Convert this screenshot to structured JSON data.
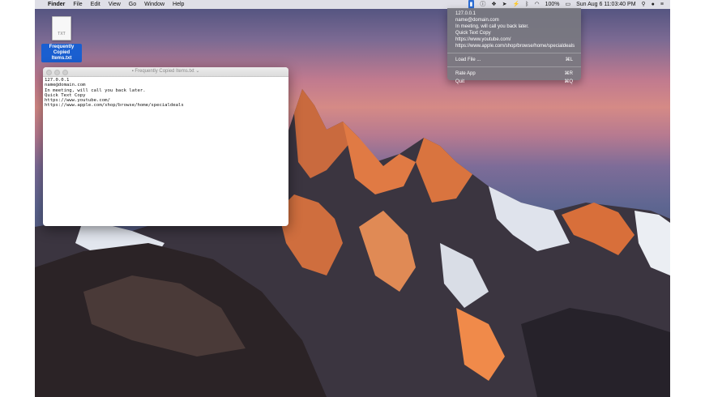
{
  "menubar": {
    "apple_icon": "apple-icon",
    "app": "Finder",
    "items": [
      "File",
      "Edit",
      "View",
      "Go",
      "Window",
      "Help"
    ],
    "battery": "100%",
    "datetime": "Sun Aug 6  11:03:40 PM"
  },
  "desktop": {
    "file_label_line1": "Frequently Copied",
    "file_label_line2": "Items.txt",
    "file_type": "TXT"
  },
  "window": {
    "title": "Frequently Copied Items.txt",
    "lines": [
      "127.0.0.1",
      "name@domain.com",
      "In meeting, will call you back later.",
      "Quick Text Copy",
      "https://www.youtube.com/",
      "https://www.apple.com/shop/browse/home/specialdeals"
    ]
  },
  "menu": {
    "clips": [
      "127.0.0.1",
      "name@domain.com",
      "In meeting, will call you back later.",
      "Quick Text Copy",
      "https://www.youtube.com/",
      "https://www.apple.com/shop/browse/home/specialdeals"
    ],
    "load_file": "Load File ...",
    "load_file_shortcut": "⌘L",
    "rate_app": "Rate App",
    "rate_app_shortcut": "⌘R",
    "quit": "Quit",
    "quit_shortcut": "⌘Q"
  }
}
